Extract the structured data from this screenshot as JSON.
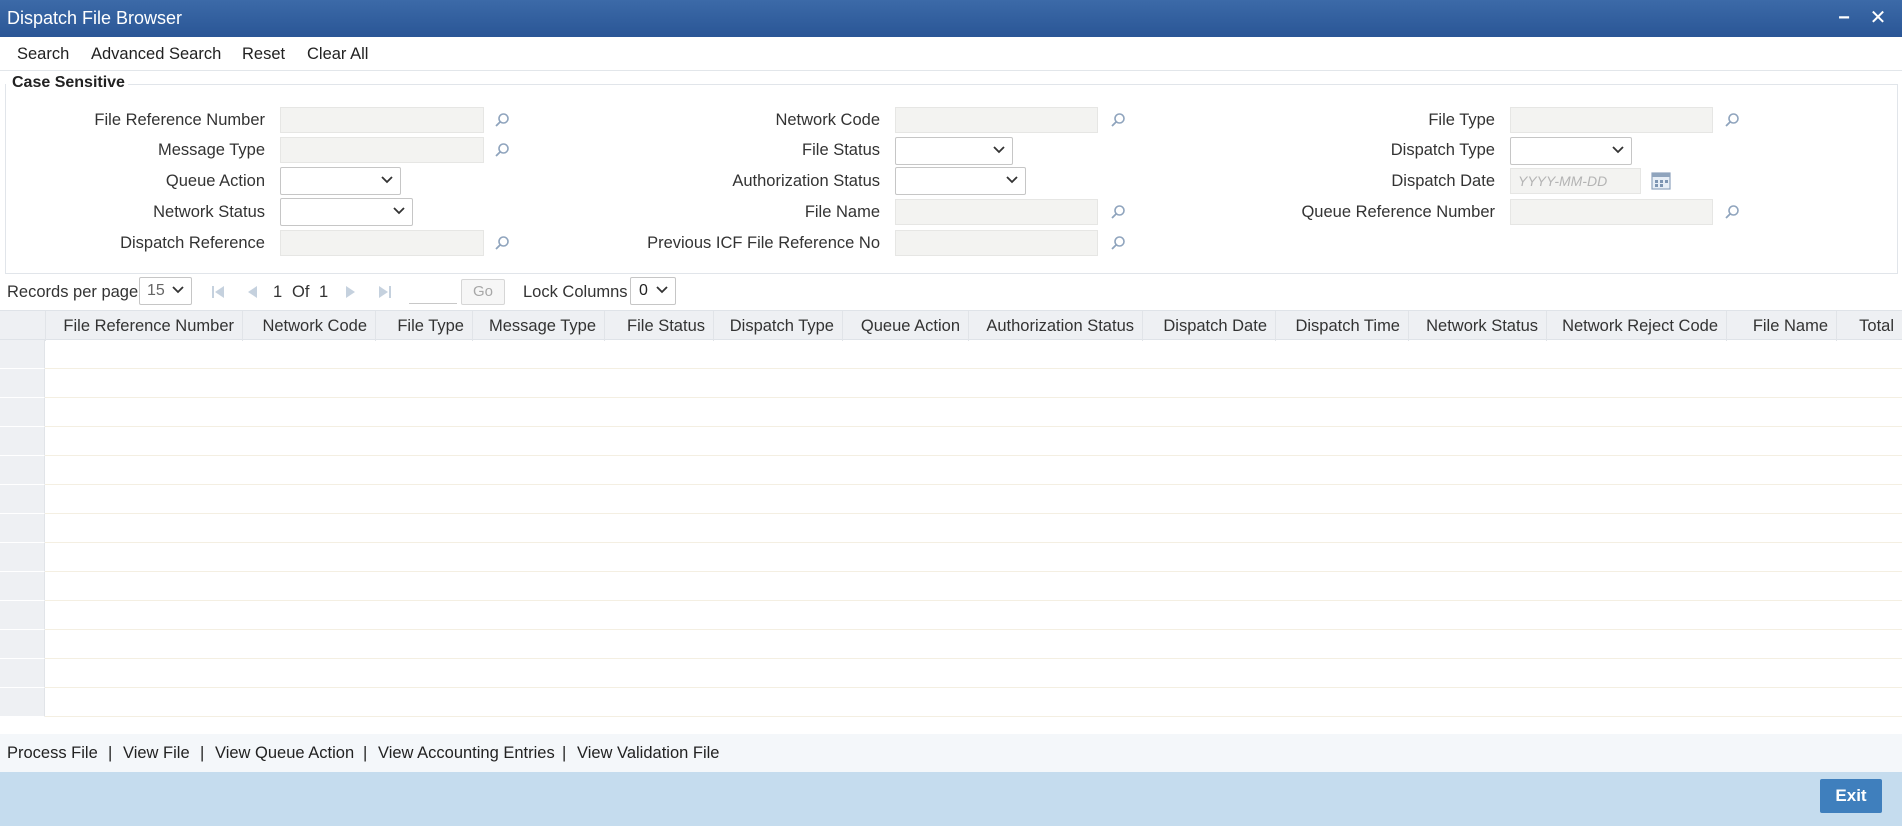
{
  "window": {
    "title": "Dispatch File Browser",
    "minimize_glyph": "−",
    "close_glyph": "✕"
  },
  "toolbar": {
    "search": "Search",
    "advanced_search": "Advanced Search",
    "reset": "Reset",
    "clear_all": "Clear All"
  },
  "criteria": {
    "legend": "Case Sensitive",
    "file_reference_number": "File Reference Number",
    "message_type": "Message Type",
    "queue_action": "Queue Action",
    "network_status": "Network Status",
    "dispatch_reference": "Dispatch Reference",
    "network_code": "Network Code",
    "file_status": "File Status",
    "authorization_status": "Authorization Status",
    "file_name": "File Name",
    "previous_icf": "Previous ICF File Reference No",
    "file_type": "File Type",
    "dispatch_type": "Dispatch Type",
    "dispatch_date": "Dispatch Date",
    "dispatch_date_placeholder": "YYYY-MM-DD",
    "queue_reference_number": "Queue Reference Number"
  },
  "pager": {
    "records_per_page_label": "Records per page",
    "records_per_page_value": "15",
    "current_page": "1",
    "of_label": "Of",
    "total_pages": "1",
    "go_label": "Go",
    "lock_columns_label": "Lock Columns",
    "lock_columns_value": "0"
  },
  "grid": {
    "columns": [
      "File Reference Number",
      "Network Code",
      "File Type",
      "Message Type",
      "File Status",
      "Dispatch Type",
      "Queue Action",
      "Authorization Status",
      "Dispatch Date",
      "Dispatch Time",
      "Network Status",
      "Network Reject Code",
      "File Name",
      "Total"
    ]
  },
  "footer": {
    "links": [
      "Process File",
      "View File",
      "View Queue Action",
      "View Accounting Entries",
      "View Validation File"
    ],
    "separator": "|",
    "exit": "Exit"
  },
  "colors": {
    "titlebar": "#2f5b9b",
    "bottom_bar": "#c5dcee",
    "exit_button": "#3f7fbd"
  }
}
